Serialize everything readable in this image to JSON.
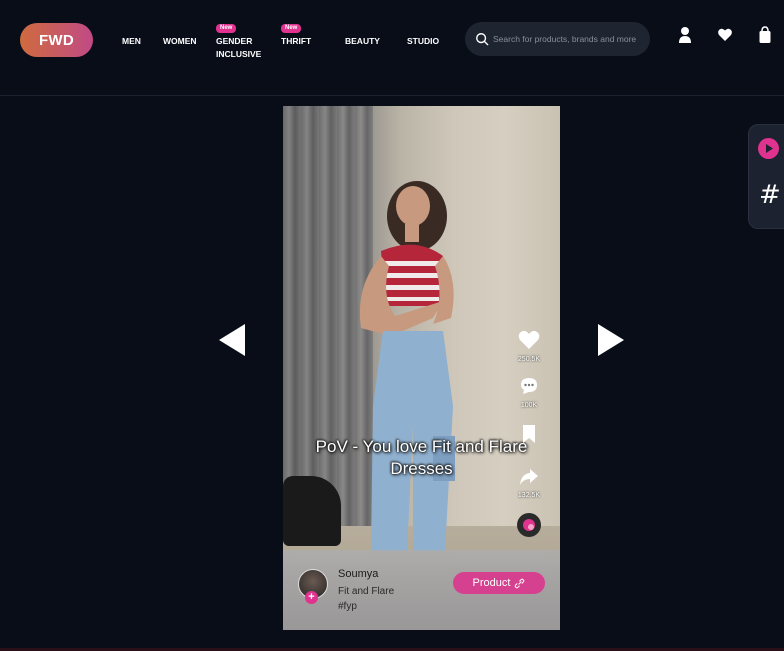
{
  "header": {
    "logo": "FWD",
    "nav": [
      {
        "label": "MEN",
        "badge": ""
      },
      {
        "label": "WOMEN",
        "badge": ""
      },
      {
        "label": "GENDER INCLUSIVE",
        "badge": "New"
      },
      {
        "label": "THRIFT",
        "badge": "New"
      },
      {
        "label": "BEAUTY",
        "badge": ""
      },
      {
        "label": "STUDIO",
        "badge": ""
      }
    ],
    "search_placeholder": "Search for products, brands and more",
    "icons": [
      "user-icon",
      "heart-icon",
      "bag-icon"
    ]
  },
  "video": {
    "caption": "PoV - You love Fit and Flare Dresses",
    "likes": "250.5K",
    "comments": "100K",
    "shares": "132.5K",
    "creator": "Soumya",
    "title": "Fit and Flare",
    "tag": "#fyp",
    "product_label": "Product"
  },
  "side_panel": {
    "hash_symbol": "#"
  },
  "colors": {
    "background": "#080d18",
    "accent": "#e0328f",
    "logo_gradient": [
      "#cf6b3e",
      "#c14a86"
    ]
  }
}
